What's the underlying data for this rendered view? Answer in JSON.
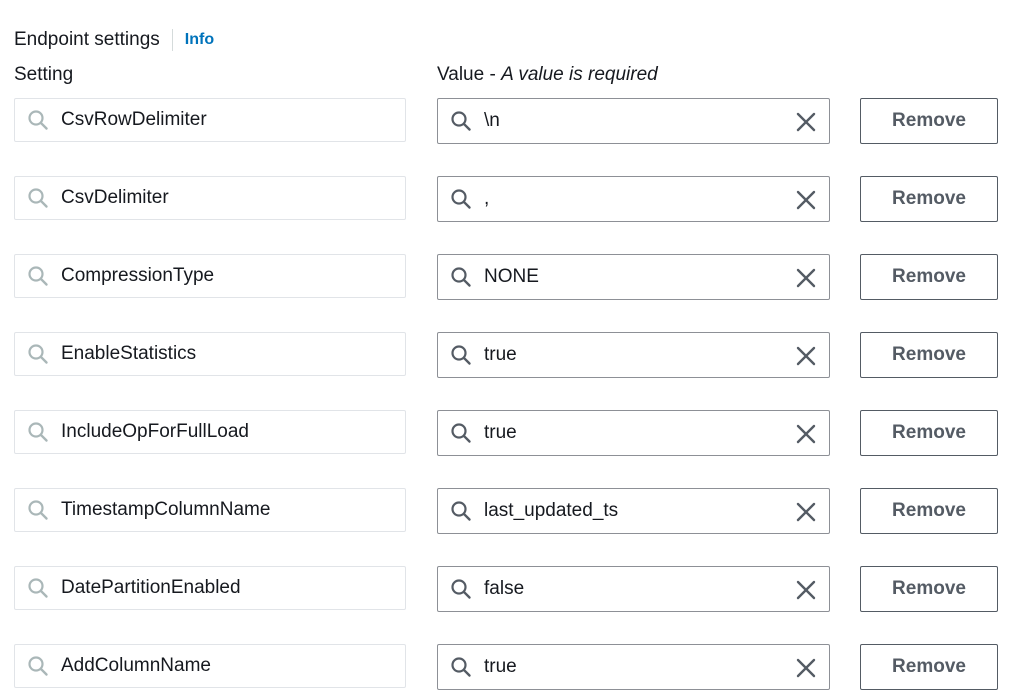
{
  "header": {
    "title": "Endpoint settings",
    "info_label": "Info"
  },
  "columns": {
    "setting": "Setting",
    "value": "Value - ",
    "value_required": "A value is required"
  },
  "remove_label": "Remove",
  "icons": {
    "setting_search": "search-icon",
    "value_search": "search-icon",
    "clear": "close-icon"
  },
  "colors": {
    "link": "#0073bb",
    "text": "#16191f",
    "button_border": "#545b64"
  },
  "rows": [
    {
      "setting": "CsvRowDelimiter",
      "value": "\\n"
    },
    {
      "setting": "CsvDelimiter",
      "value": ","
    },
    {
      "setting": "CompressionType",
      "value": "NONE"
    },
    {
      "setting": "EnableStatistics",
      "value": "true"
    },
    {
      "setting": "IncludeOpForFullLoad",
      "value": "true"
    },
    {
      "setting": "TimestampColumnName",
      "value": "last_updated_ts"
    },
    {
      "setting": "DatePartitionEnabled",
      "value": "false"
    },
    {
      "setting": "AddColumnName",
      "value": "true"
    }
  ]
}
